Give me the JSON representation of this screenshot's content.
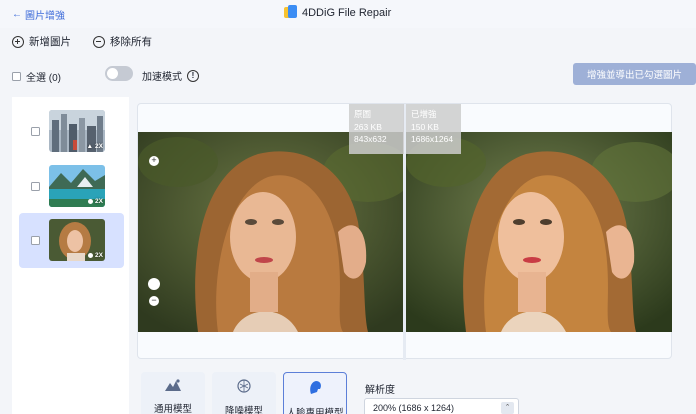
{
  "header": {
    "back_label": "圖片增強",
    "app_title": "4DDiG File Repair"
  },
  "toolbar": {
    "add_label": "新增圖片",
    "remove_all_label": "移除所有"
  },
  "controls": {
    "select_all_label": "全選 (0)",
    "accel_label": "加速模式",
    "accel_on": false,
    "export_label": "增強並導出已勾選圖片"
  },
  "sidebar": {
    "items": [
      {
        "badge": "2X",
        "icon": "mountain-icon",
        "selected": false
      },
      {
        "badge": "2X",
        "icon": "dot-icon",
        "selected": false
      },
      {
        "badge": "2X",
        "icon": "face-icon",
        "selected": true
      }
    ]
  },
  "preview": {
    "original": {
      "label": "原圖",
      "size": "263 KB",
      "dimensions": "843x632"
    },
    "enhanced": {
      "label": "已增強",
      "size": "150 KB",
      "dimensions": "1686x1264"
    }
  },
  "models": [
    {
      "label": "通用模型",
      "icon": "landscape-icon",
      "active": false
    },
    {
      "label": "降噪模型",
      "icon": "denoise-icon",
      "active": false
    },
    {
      "label": "人臉專用模型",
      "icon": "face-model-icon",
      "active": true
    }
  ],
  "resolution": {
    "label": "解析度",
    "value": "200% (1686 x 1264)"
  },
  "colors": {
    "accent": "#3d6bd9",
    "export_bg": "#9eb0d7",
    "selected_item": "#d7e1ff"
  }
}
